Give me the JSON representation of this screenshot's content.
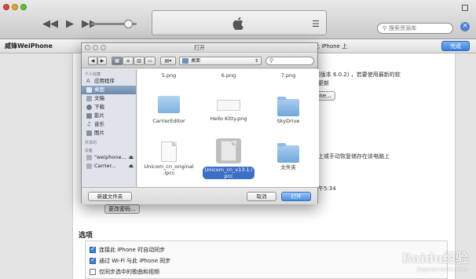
{
  "titlebar": {
    "search_placeholder": "搜索资源库",
    "list_icon": "list-icon"
  },
  "devicebar": {
    "device_name": "威锋WeiPhone",
    "backup_text": "此 iPhone 上",
    "done_label": "完成"
  },
  "content": {
    "line1": "(版本 6.0.2) ，若要使用最新的软",
    "line2": "更新",
    "frag_btn": "one...",
    "line3": "上或手动恢复储存在该电脑上",
    "line4": "午5:34",
    "frag_btn2": "更改密码..."
  },
  "options": {
    "title": "选项",
    "items": [
      {
        "label": "连接此 iPhone 时自动同步",
        "checked": true
      },
      {
        "label": "通过 Wi-Fi 与此 iPhone 同步",
        "checked": true
      },
      {
        "label": "仅同步选中的歌曲和视频",
        "checked": false
      }
    ]
  },
  "dialog": {
    "title": "打开",
    "location": "桌面",
    "search_placeholder": "",
    "sidebar": {
      "header_personal": "个人收藏",
      "items": [
        {
          "label": "应用程序",
          "icon": "applications-icon",
          "selected": false
        },
        {
          "label": "桌面",
          "icon": "desktop-icon",
          "selected": true
        },
        {
          "label": "文稿",
          "icon": "documents-icon",
          "selected": false
        },
        {
          "label": "下载",
          "icon": "downloads-icon",
          "selected": false
        },
        {
          "label": "影片",
          "icon": "movies-icon",
          "selected": false
        },
        {
          "label": "音乐",
          "icon": "music-icon",
          "selected": false
        },
        {
          "label": "图片",
          "icon": "pictures-icon",
          "selected": false
        }
      ],
      "header_shared": "共享的",
      "header_devices": "设备",
      "devices": [
        {
          "label": "\"weiphone...",
          "icon": "disk-icon"
        },
        {
          "label": "Carrier...",
          "icon": "disk-icon"
        }
      ]
    },
    "files": [
      {
        "name": "5.png",
        "kind": "partial"
      },
      {
        "name": "6.png",
        "kind": "partial"
      },
      {
        "name": "7.png",
        "kind": "partial"
      },
      {
        "name": "CarrierEditor",
        "kind": "app"
      },
      {
        "name": "Hello Kitty.png",
        "kind": "image"
      },
      {
        "name": "SkyDrive",
        "kind": "folder"
      },
      {
        "name": "Unicom_cn_original\n.ipcc",
        "kind": "doc"
      },
      {
        "name": "Unicom_cn_v13.1.i\npcc",
        "kind": "doc",
        "selected": true
      },
      {
        "name": "文件夹",
        "kind": "folder"
      }
    ],
    "new_folder_label": "新建文件夹",
    "cancel_label": "取消",
    "open_label": "打开"
  },
  "watermark": {
    "text": "Baidu经验",
    "sub": "jingyan.baidu.com"
  },
  "colors": {
    "accent": "#3d7fd9",
    "selection": "#3d6fc4"
  }
}
